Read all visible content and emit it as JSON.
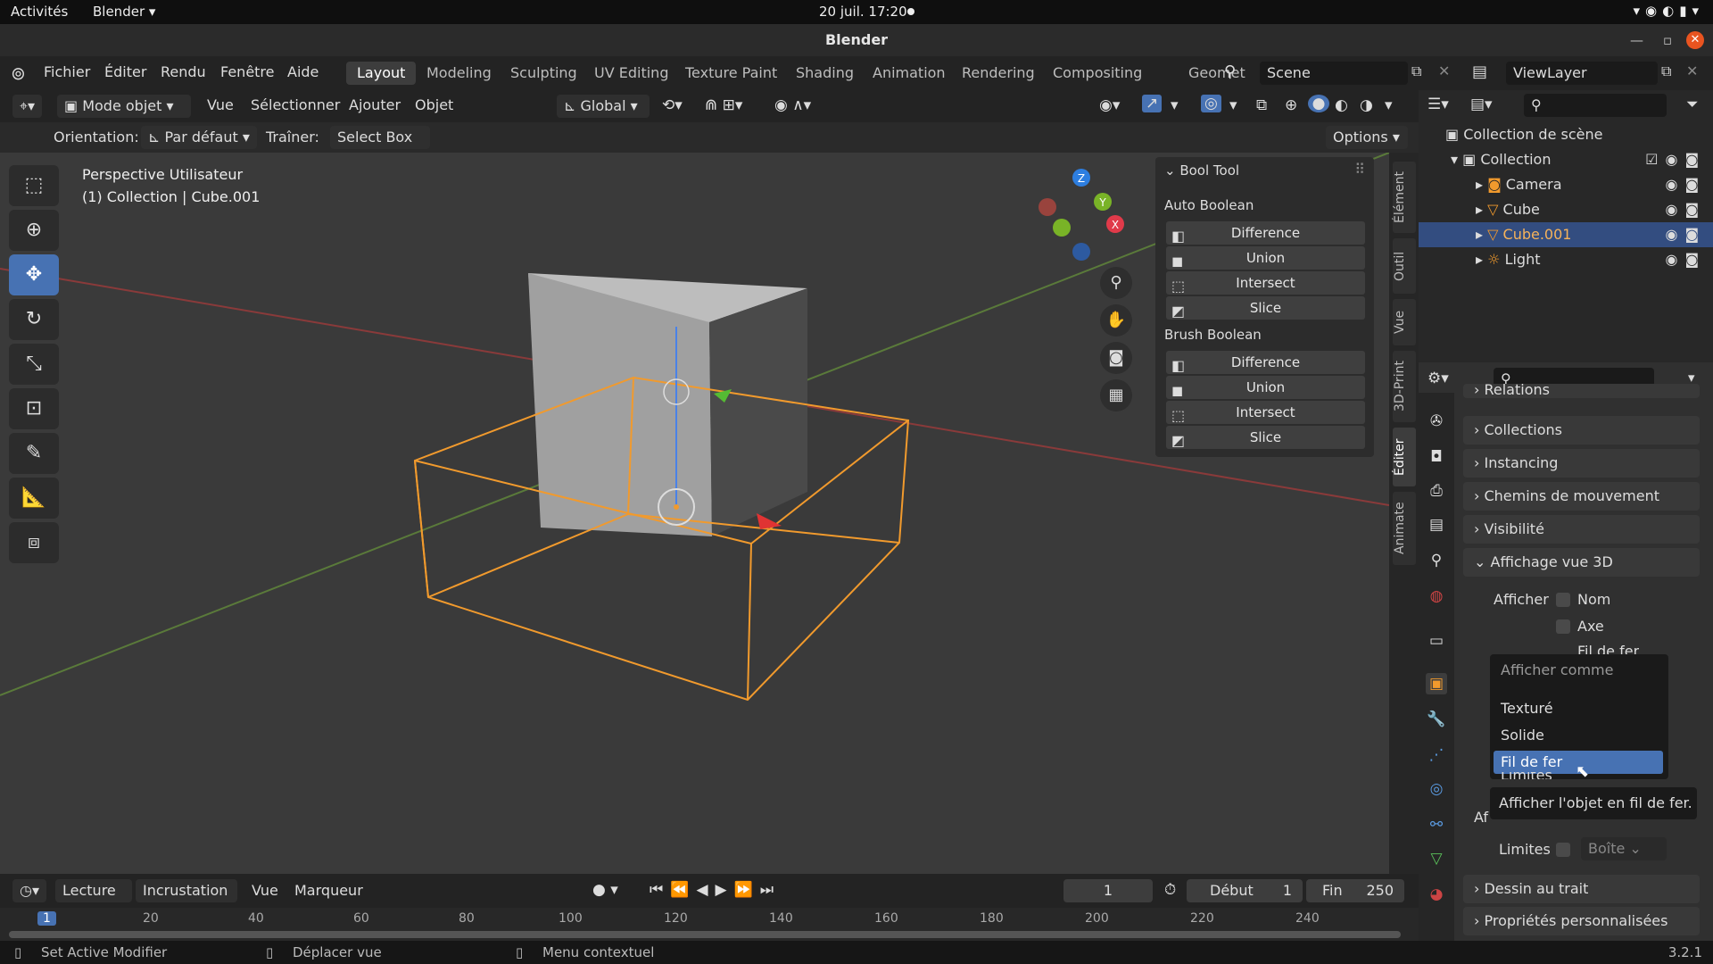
{
  "gnome": {
    "activities": "Activités",
    "app": "Blender ▾",
    "clock": "20 juil.  17:20"
  },
  "window": {
    "title": "Blender"
  },
  "menus": [
    "Fichier",
    "Éditer",
    "Rendu",
    "Fenêtre",
    "Aide"
  ],
  "workspaces": [
    "Layout",
    "Modeling",
    "Sculpting",
    "UV Editing",
    "Texture Paint",
    "Shading",
    "Animation",
    "Rendering",
    "Compositing",
    "Geomet"
  ],
  "scene": {
    "label": "Scene",
    "viewlayer": "ViewLayer"
  },
  "header": {
    "mode": "Mode objet",
    "vue": "Vue",
    "select": "Sélectionner",
    "add": "Ajouter",
    "object": "Objet",
    "transform": "Global"
  },
  "header2": {
    "orientation_label": "Orientation:",
    "orientation": "Par défaut",
    "drag_label": "Traîner:",
    "drag": "Select Box",
    "options": "Options"
  },
  "viewport": {
    "line1": "Perspective Utilisateur",
    "line2": "(1) Collection | Cube.001"
  },
  "bool_tool": {
    "title": "Bool Tool",
    "auto_title": "Auto Boolean",
    "auto": [
      "Difference",
      "Union",
      "Intersect",
      "Slice"
    ],
    "brush_title": "Brush Boolean",
    "brush": [
      "Difference",
      "Union",
      "Intersect",
      "Slice"
    ]
  },
  "side_tabs": [
    "Élément",
    "Outil",
    "Vue",
    "3D-Print",
    "Éditer",
    "Animate"
  ],
  "timeline": {
    "play": "Lecture",
    "keying": "Incrustation",
    "view": "Vue",
    "markers": "Marqueur",
    "frame": "1",
    "start_label": "Début",
    "start": "1",
    "end_label": "Fin",
    "end": "250",
    "ticks": [
      "1",
      "20",
      "40",
      "60",
      "80",
      "100",
      "120",
      "140",
      "160",
      "180",
      "200",
      "220",
      "240"
    ]
  },
  "status": {
    "a": "Set Active Modifier",
    "b": "Déplacer vue",
    "c": "Menu contextuel",
    "version": "3.2.1"
  },
  "outliner": {
    "scene_collection": "Collection de scène",
    "items": [
      {
        "name": "Collection"
      },
      {
        "name": "Camera"
      },
      {
        "name": "Cube"
      },
      {
        "name": "Cube.001"
      },
      {
        "name": "Light"
      }
    ]
  },
  "properties": {
    "sections": [
      "Relations",
      "Collections",
      "Instancing",
      "Chemins de mouvement",
      "Visibilité",
      "Affichage vue 3D",
      "Dessin au trait",
      "Propriétés personnalisées"
    ],
    "show_label": "Afficher",
    "checks": [
      "Nom",
      "Axe",
      "Fil de fer"
    ],
    "limits_label": "Limites",
    "limits_value": "Boîte",
    "af_label": "Af"
  },
  "dropdown": {
    "title": "Afficher comme",
    "items": [
      "Texturé",
      "Solide",
      "Fil de fer",
      "Limites"
    ],
    "tooltip": "Afficher l'objet en fil de fer."
  }
}
